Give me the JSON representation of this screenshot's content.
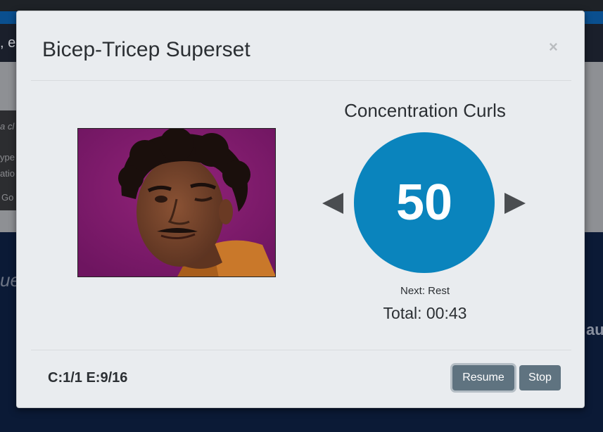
{
  "background": {
    "nav_fragment": ", e",
    "hero_line1": "a cl",
    "hero_line2": "ype",
    "hero_line3": "atio",
    "hero_line4": "Go",
    "section_fragment_left": "ue",
    "section_fragment_right": "au"
  },
  "modal": {
    "title": "Bicep-Tricep Superset",
    "close_glyph": "×",
    "exercise": {
      "name": "Concentration Curls",
      "image_icon": "exercise-photo",
      "counter": "50",
      "next": "Next: Rest",
      "total": "Total: 00:43",
      "prev_icon": "triangle-left-icon",
      "next_icon": "triangle-right-icon"
    },
    "footer": {
      "progress": "C:1/1 E:9/16",
      "resume_label": "Resume",
      "stop_label": "Stop"
    }
  },
  "colors": {
    "counter_circle": "#0a84bd",
    "button": "#5f7380",
    "modal_bg": "#e9ecef"
  }
}
